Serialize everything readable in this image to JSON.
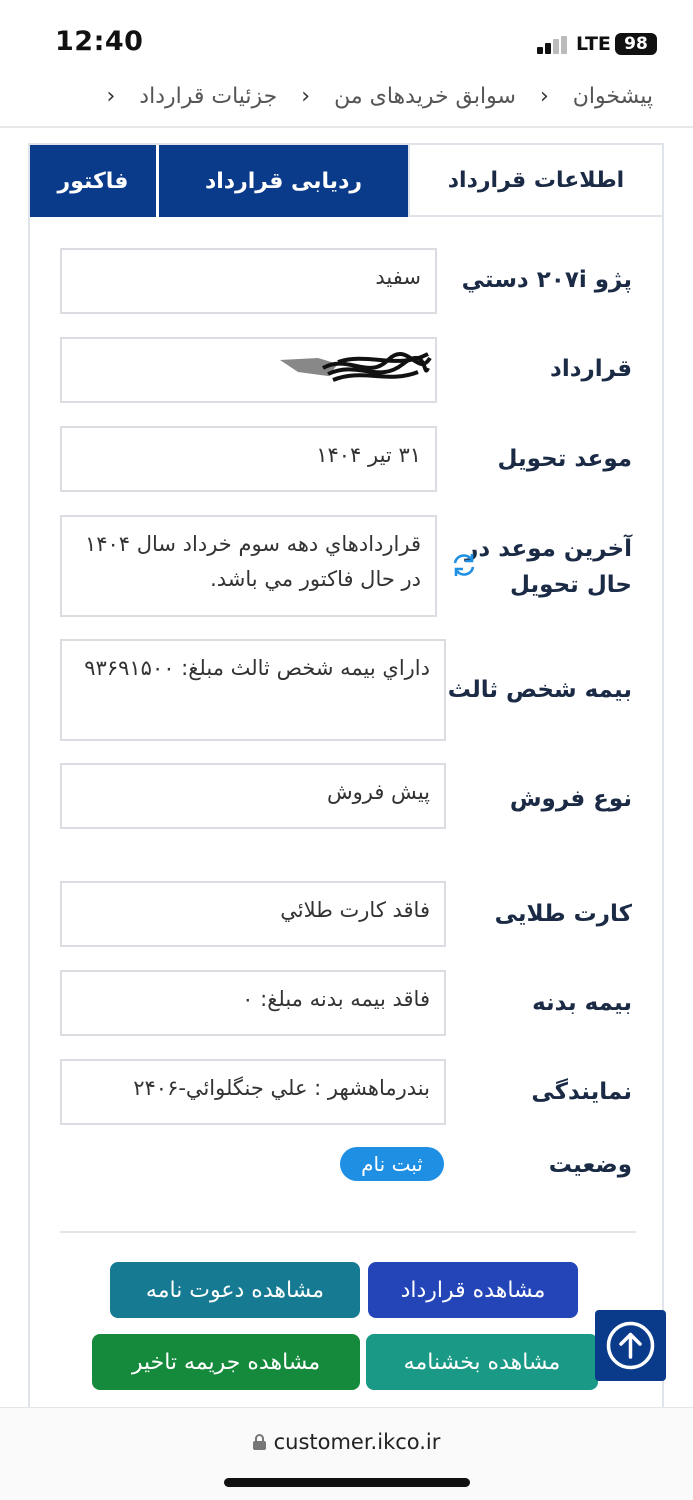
{
  "status_bar": {
    "time": "12:40",
    "network": "LTE",
    "battery": "98"
  },
  "breadcrumb": {
    "items": [
      "پیشخوان",
      "سوابق خریدهای من",
      "جزئیات قرارداد"
    ]
  },
  "tabs": {
    "info": "اطلاعات قرارداد",
    "tracking": "ردیابی قرارداد",
    "invoice": "فاکتور"
  },
  "details": {
    "car_label": "پژو ۲۰۷i دستي",
    "car_value": "سفيد",
    "contract_label": "قرارداد",
    "delivery_label": "موعد تحویل",
    "delivery_value": "۳۱ تیر ۱۴۰۴",
    "last_delivery_label": "آخرین موعد در حال تحویل",
    "last_delivery_value": "قراردادهاي دهه سوم خرداد سال ۱۴۰۴ در حال فاکتور مي باشد.",
    "third_party_label": "بیمه شخص ثالث",
    "third_party_value": "داراي بيمه شخص ثالث مبلغ: ۹۳۶۹۱۵۰۰",
    "sale_type_label": "نوع فروش",
    "sale_type_value": "پیش فروش",
    "gold_card_label": "کارت طلایی",
    "gold_card_value": "فاقد کارت طلائي",
    "body_ins_label": "بیمه بدنه",
    "body_ins_value": "فاقد بيمه بدنه مبلغ: ۰",
    "agency_label": "نمایندگی",
    "agency_value": "بندرماهشهر : علي جنگلوائي-۲۴۰۶",
    "status_label": "وضعیت",
    "status_value": "ثبت نام"
  },
  "buttons": {
    "view_contract": "مشاهده قرارداد",
    "view_invitation": "مشاهده دعوت نامه",
    "view_circular": "مشاهده بخشنامه",
    "view_penalty": "مشاهده جریمه تاخیر"
  },
  "url_bar": {
    "url": "customer.ikco.ir"
  },
  "colors": {
    "primary": "#0a3a8a",
    "contract_btn": "#2345b8",
    "invite_btn": "#167a93",
    "circular_btn": "#1a9a86",
    "penalty_btn": "#168a3c",
    "badge": "#1e8fe3"
  }
}
